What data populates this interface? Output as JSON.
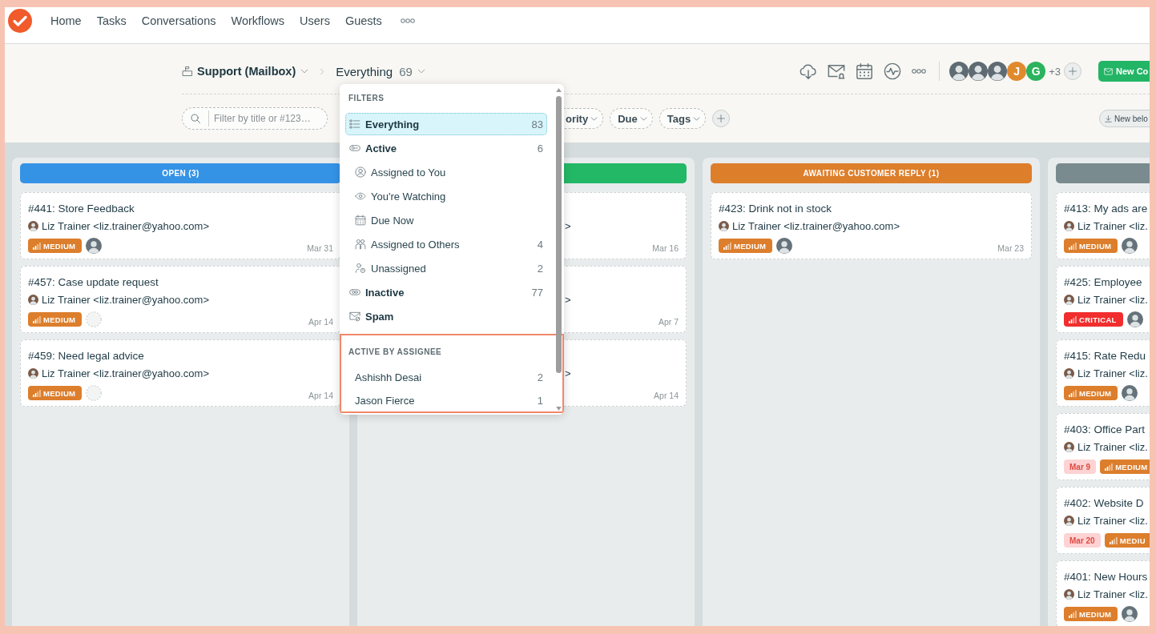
{
  "nav": {
    "items": [
      "Home",
      "Tasks",
      "Conversations",
      "Workflows",
      "Users",
      "Guests"
    ]
  },
  "header": {
    "breadcrumb": {
      "mailbox": "Support (Mailbox)",
      "view": "Everything",
      "count": "69"
    },
    "members": [
      {
        "kind": "photo"
      },
      {
        "kind": "photo"
      },
      {
        "kind": "photo"
      },
      {
        "kind": "letter",
        "letter": "J",
        "color": "#e08a2e"
      },
      {
        "kind": "letter",
        "letter": "G",
        "color": "#2bb35e"
      }
    ],
    "more_members": "+3",
    "new_button": "New Co"
  },
  "filter_bar": {
    "search": {
      "placeholder": "Filter by title or #123…"
    },
    "pills": [
      "ority",
      "Due",
      "Tags"
    ],
    "new_below_button": "New belo"
  },
  "filter_menu": {
    "heading": "FILTERS",
    "items": [
      {
        "label": "Everything",
        "count": "83",
        "selected": true
      },
      {
        "label": "Active",
        "count": "6",
        "selected": false,
        "children": [
          {
            "label": "Assigned to You",
            "selected": false
          },
          {
            "label": "You're Watching",
            "selected": false
          },
          {
            "label": "Due Now",
            "selected": false
          },
          {
            "label": "Assigned to Others",
            "count": "4",
            "selected": false
          },
          {
            "label": "Unassigned",
            "count": "2",
            "selected": false
          }
        ]
      },
      {
        "label": "Inactive",
        "count": "77",
        "selected": false
      },
      {
        "label": "Spam",
        "selected": false
      }
    ],
    "assignee_section": {
      "highlighted": true,
      "heading": "ACTIVE BY ASSIGNEE",
      "items": [
        {
          "name": "Ashishh Desai",
          "count": "2",
          "selected": false
        },
        {
          "name": "Jason Fierce",
          "count": "1",
          "selected": false
        }
      ]
    }
  },
  "board": {
    "columns": [
      {
        "label": "OPEN (3)",
        "color": "#3593e6",
        "cards": [
          {
            "title": "#441: Store Feedback",
            "requester": "Liz Trainer <liz.trainer@yahoo.com>",
            "priority": {
              "label": "MEDIUM",
              "color": "#dc7e2c"
            },
            "assigned": true,
            "date": "Mar 31"
          },
          {
            "title": "#457: Case update request",
            "requester": "Liz Trainer <liz.trainer@yahoo.com>",
            "priority": {
              "label": "MEDIUM",
              "color": "#dc7e2c"
            },
            "assigned": false,
            "date": "Apr 14"
          },
          {
            "title": "#459: Need legal advice",
            "requester": "Liz Trainer <liz.trainer@yahoo.com>",
            "priority": {
              "label": "MEDIUM",
              "color": "#dc7e2c"
            },
            "assigned": false,
            "date": "Apr 14"
          }
        ]
      },
      {
        "color": "#23b866",
        "cards": [
          {
            "requester_tail": ">",
            "date": "Mar 16"
          },
          {
            "requester_tail": ">",
            "date": "Apr 7"
          },
          {
            "requester_tail": ">",
            "date": "Apr 14"
          }
        ]
      },
      {
        "label": "AWAITING CUSTOMER REPLY (1)",
        "color": "#dd7e2b",
        "cards": [
          {
            "title": "#423: Drink not in stock",
            "requester": "Liz Trainer <liz.trainer@yahoo.com>",
            "priority": {
              "label": "MEDIUM",
              "color": "#dc7e2c"
            },
            "assigned": true,
            "date": "Mar 23"
          }
        ]
      },
      {
        "color": "#798b8e",
        "cards": [
          {
            "title": "#413: My ads are",
            "requester": "Liz Trainer <liz.",
            "priority": {
              "label": "MEDIUM",
              "color": "#dc7e2c"
            },
            "assigned": true
          },
          {
            "title": "#425: Employee",
            "requester": "Liz Trainer <liz.",
            "priority": {
              "label": "CRITICAL",
              "color": "#f12d2d"
            },
            "assigned": true
          },
          {
            "title": "#415: Rate Redu",
            "requester": "Liz Trainer <liz.",
            "priority": {
              "label": "MEDIUM",
              "color": "#dc7e2c"
            },
            "assigned": true
          },
          {
            "title": "#403: Office Part",
            "requester": "Liz Trainer <liz.",
            "due": "Mar 9",
            "priority": {
              "label": "MEDIUM",
              "color": "#dc7e2c"
            }
          },
          {
            "title": "#402: Website D",
            "requester": "Liz Trainer <liz.",
            "due": "Mar 20",
            "priority": {
              "label": "MEDIU",
              "color": "#dc7e2c"
            }
          },
          {
            "title": "#401: New Hours",
            "requester": "Liz Trainer <liz.",
            "priority": {
              "label": "MEDIUM",
              "color": "#dc7e2c"
            },
            "assigned": true
          }
        ]
      }
    ]
  }
}
